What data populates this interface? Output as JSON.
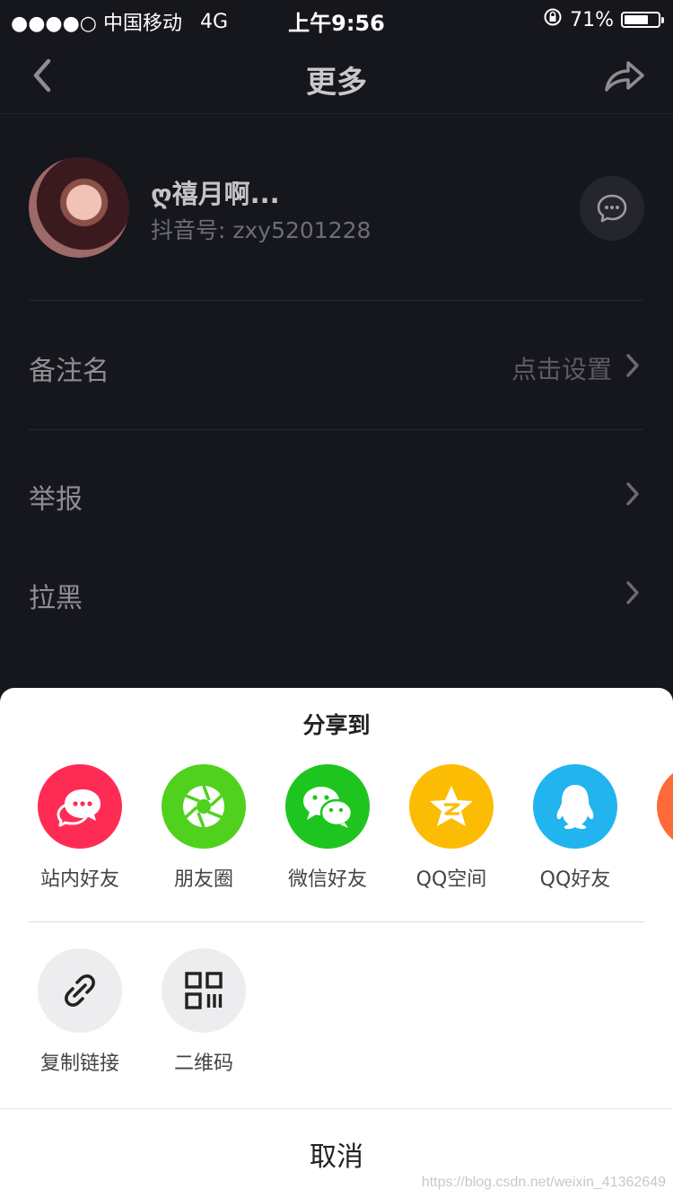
{
  "status_bar": {
    "carrier": "●●●●○ 中国移动",
    "network": "4G",
    "time": "上午9:56",
    "battery_text": "71%",
    "battery_level": 0.71
  },
  "nav": {
    "title": "更多"
  },
  "profile": {
    "name": "ღ禧月啊...",
    "id_text": "抖音号: zxy5201228"
  },
  "settings": [
    {
      "label": "备注名",
      "value": "点击设置"
    },
    {
      "label": "举报",
      "value": ""
    },
    {
      "label": "拉黑",
      "value": ""
    }
  ],
  "share_sheet": {
    "title": "分享到",
    "targets": [
      {
        "label": "站内好友",
        "color": "#fe2c55",
        "icon": "chat-bubbles-icon"
      },
      {
        "label": "朋友圈",
        "color": "#4fd11e",
        "icon": "aperture-icon"
      },
      {
        "label": "微信好友",
        "color": "#1ec51e",
        "icon": "wechat-icon"
      },
      {
        "label": "QQ空间",
        "color": "#fcbc04",
        "icon": "qzone-star-icon"
      },
      {
        "label": "QQ好友",
        "color": "#22b4ef",
        "icon": "qq-penguin-icon"
      },
      {
        "label": "",
        "color": "#ff6a3a",
        "icon": "partial-icon"
      }
    ],
    "tools": [
      {
        "label": "复制链接",
        "icon": "link-icon"
      },
      {
        "label": "二维码",
        "icon": "qr-code-icon"
      }
    ],
    "cancel": "取消"
  },
  "watermark": "https://blog.csdn.net/weixin_41362649"
}
